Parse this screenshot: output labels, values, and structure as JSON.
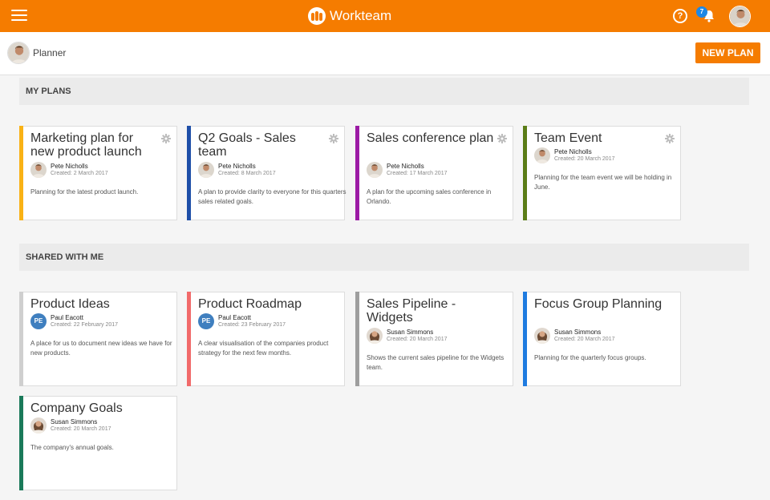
{
  "app": {
    "brand_name": "Workteam",
    "notification_count": "7",
    "help_glyph": "?"
  },
  "subbar": {
    "title": "Planner",
    "new_plan_label": "NEW PLAN"
  },
  "sections": {
    "my_plans": "MY PLANS",
    "shared_with_me": "SHARED WITH ME"
  },
  "colors": {
    "accent": "#f57c00",
    "badge": "#1e88e5"
  },
  "my_plans": [
    {
      "title": "Marketing plan for new product launch",
      "owner": "Pete Nicholls",
      "created": "Created: 2 March 2017",
      "description": "Planning for the latest product launch.",
      "color": "#f9b215"
    },
    {
      "title": "Q2 Goals - Sales team",
      "owner": "Pete Nicholls",
      "created": "Created: 8 March 2017",
      "description": "A plan to provide clarity to everyone for this quarters sales related goals.",
      "color": "#1f4fa8"
    },
    {
      "title": "Sales conference plan",
      "owner": "Pete Nicholls",
      "created": "Created: 17 March 2017",
      "description": "A plan for the upcoming sales conference in Orlando.",
      "color": "#9c1aa5"
    },
    {
      "title": "Team Event",
      "owner": "Pete Nicholls",
      "created": "Created: 20 March 2017",
      "description": "Planning for the team event we will be holding in June.",
      "color": "#5b7d17"
    }
  ],
  "shared_plans": [
    {
      "title": "Product Ideas",
      "owner": "Paul Eacott",
      "initials": "PE",
      "created": "Created: 22 February 2017",
      "description": "A place for us to document new ideas we have for new products.",
      "color": "#cfcfcf"
    },
    {
      "title": "Product Roadmap",
      "owner": "Paul Eacott",
      "initials": "PE",
      "created": "Created: 23 February 2017",
      "description": "A clear visualisation of the companies product strategy for the next few months.",
      "color": "#f16a6a"
    },
    {
      "title": "Sales Pipeline - Widgets",
      "owner": "Susan Simmons",
      "created": "Created: 20 March 2017",
      "description": "Shows the current sales pipeline for the Widgets team.",
      "color": "#9e9e9e"
    },
    {
      "title": "Focus Group Planning",
      "owner": "Susan Simmons",
      "created": "Created: 20 March 2017",
      "description": "Planning for the quarterly focus groups.",
      "color": "#1e7be0"
    },
    {
      "title": "Company Goals",
      "owner": "Susan Simmons",
      "created": "Created: 20 March 2017",
      "description": "The company's annual goals.",
      "color": "#1a7a5a"
    }
  ]
}
